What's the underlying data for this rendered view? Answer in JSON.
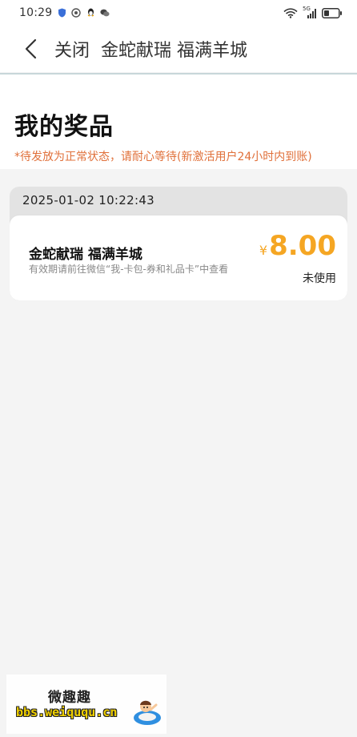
{
  "status_bar": {
    "time": "10:29",
    "network_label": "5G",
    "icons": [
      "shield-icon",
      "app-icon",
      "qq-icon",
      "wechat-icon",
      "wifi-icon",
      "signal-icon",
      "battery-icon"
    ]
  },
  "nav": {
    "back_icon": "chevron-left-icon",
    "close_label": "关闭",
    "title": "金蛇献瑞 福满羊城"
  },
  "header": {
    "title": "我的奖品",
    "notice": "*待发放为正常状态，请耐心等待(新激活用户24小时内到账)"
  },
  "records": [
    {
      "date": "2025-01-02 10:22:43",
      "prize_name": "金蛇献瑞 福满羊城",
      "prize_desc": "有效期请前往微信“我-卡包-券和礼品卡”中查看",
      "currency": "¥",
      "amount": "8.00",
      "status": "未使用"
    }
  ],
  "watermark": {
    "title": "微趣趣",
    "url": "bbs.weiququ.cn"
  },
  "colors": {
    "accent_orange": "#e0703a",
    "amount_gold": "#f5a623",
    "background": "#f4f4f4"
  }
}
